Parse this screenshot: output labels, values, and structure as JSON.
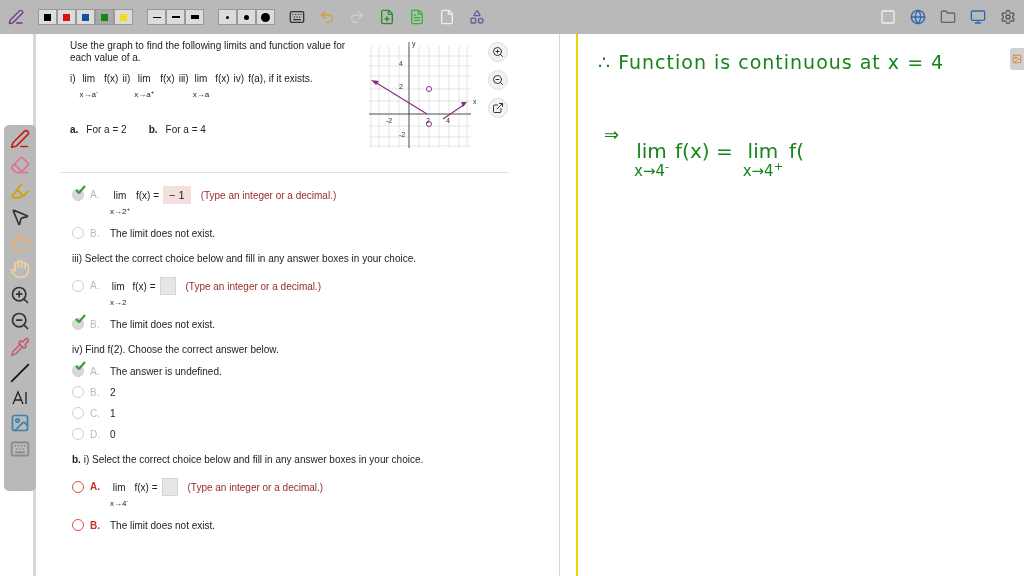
{
  "toolbar": {
    "colors": [
      {
        "color": "#000000",
        "selected": false
      },
      {
        "color": "#e01010",
        "selected": false
      },
      {
        "color": "#1050a0",
        "selected": false
      },
      {
        "color": "#108a10",
        "selected": true
      },
      {
        "color": "#f0e010",
        "selected": false
      }
    ]
  },
  "problem": {
    "intro": "Use the graph to find the following limits and function value for each value of a.",
    "parts": [
      {
        "label": "i)",
        "kind": "limit",
        "lim": "lim",
        "expr": "f(x)",
        "sub": "x→a$^{-}$"
      },
      {
        "label": "ii)",
        "kind": "limit",
        "lim": "lim",
        "expr": "f(x)",
        "sub": "x→a$^{+}$"
      },
      {
        "label": "iii)",
        "kind": "limit",
        "lim": "lim",
        "expr": "f(x)",
        "sub": "x→a"
      },
      {
        "label": "iv)",
        "kind": "text",
        "text": "f(a), if it exists."
      }
    ],
    "cases": [
      {
        "label": "a.",
        "text": "For a = 2"
      },
      {
        "label": "b.",
        "text": "For a = 4"
      }
    ]
  },
  "graph": {
    "axis_labels": [
      "x",
      "y"
    ],
    "x_ticks": [
      "-2",
      "2",
      "4"
    ],
    "y_ticks": [
      "4",
      "2",
      "-2"
    ]
  },
  "items": [
    {
      "kind": "limit",
      "letter": "A.",
      "selected": true,
      "active": false,
      "lim": "lim",
      "expr": "f(x) =",
      "sub": "x→2$^{+}$",
      "value": "− 1",
      "hint": "(Type an integer or a decimal.)"
    },
    {
      "kind": "choice",
      "letter": "B.",
      "selected": false,
      "active": false,
      "text": "The limit does not exist."
    },
    {
      "kind": "prompt",
      "text": "iii) Select the correct choice below and fill in any answer boxes in your choice."
    },
    {
      "kind": "limit",
      "letter": "A.",
      "selected": false,
      "active": false,
      "lim": "lim",
      "expr": "f(x) =",
      "sub": "x→2",
      "hint": "(Type an integer or a decimal.)"
    },
    {
      "kind": "choice",
      "letter": "B.",
      "selected": true,
      "active": false,
      "text": "The limit does not exist."
    },
    {
      "kind": "prompt",
      "text": "iv) Find f(2). Choose the correct answer below."
    },
    {
      "kind": "choice",
      "letter": "A.",
      "selected": true,
      "active": false,
      "text": "The answer is undefined."
    },
    {
      "kind": "choice",
      "letter": "B.",
      "selected": false,
      "active": false,
      "text": "2"
    },
    {
      "kind": "choice",
      "letter": "C.",
      "selected": false,
      "active": false,
      "text": "1"
    },
    {
      "kind": "choice",
      "letter": "D.",
      "selected": false,
      "active": false,
      "text": "0"
    },
    {
      "kind": "prompt",
      "text": "**b.** i) Select the correct choice below and fill in any answer boxes in your choice."
    },
    {
      "kind": "limit",
      "letter": "A.",
      "selected": false,
      "active": true,
      "lim": "lim",
      "expr": "f(x) =",
      "sub": "x→4$^{-}$",
      "hint": "(Type an integer or a decimal.)"
    },
    {
      "kind": "choice",
      "letter": "B.",
      "selected": false,
      "active": true,
      "text": "The limit does not exist."
    }
  ],
  "notes": {
    "line1": "∴ Function is continuous at x = 4",
    "arrow": "⇒",
    "lim1": "lim",
    "expr1": "f(x) =",
    "sub1": "x→4$^{-}$",
    "lim2": "lim",
    "expr2": "f(",
    "sub2": "x→4$^{+}$"
  }
}
